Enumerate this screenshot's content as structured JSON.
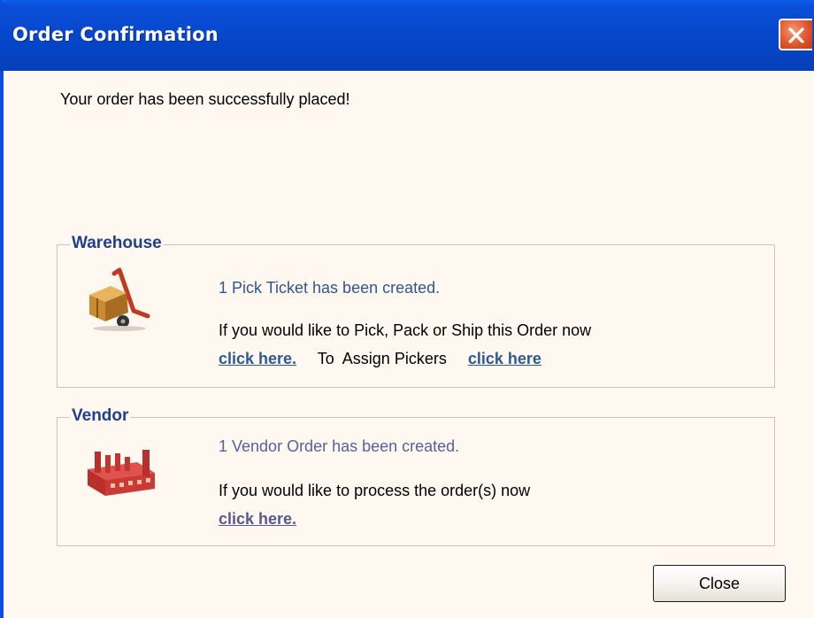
{
  "window": {
    "title": "Order Confirmation"
  },
  "message": "Your order has been successfully placed!",
  "warehouse": {
    "legend": "Warehouse",
    "status": "1 Pick Ticket has been created.",
    "prompt": "If you would like to Pick, Pack or Ship this Order now",
    "pick_link": "click here.",
    "assign_text": "To  Assign Pickers",
    "assign_link": "click here",
    "icon": "hand-truck-icon"
  },
  "vendor": {
    "legend": "Vendor",
    "status": "1 Vendor Order has been created.",
    "prompt": "If you would like to process the order(s) now",
    "process_link": "click here.",
    "icon": "factory-icon"
  },
  "buttons": {
    "close_label": "Close"
  },
  "colors": {
    "titlebar": "#0545c8",
    "background": "#fef8f1",
    "legend": "#1f3f8f",
    "warehouse_link": "#2d5a93",
    "vendor_link": "#56598f",
    "close_x": "#e0552c"
  }
}
